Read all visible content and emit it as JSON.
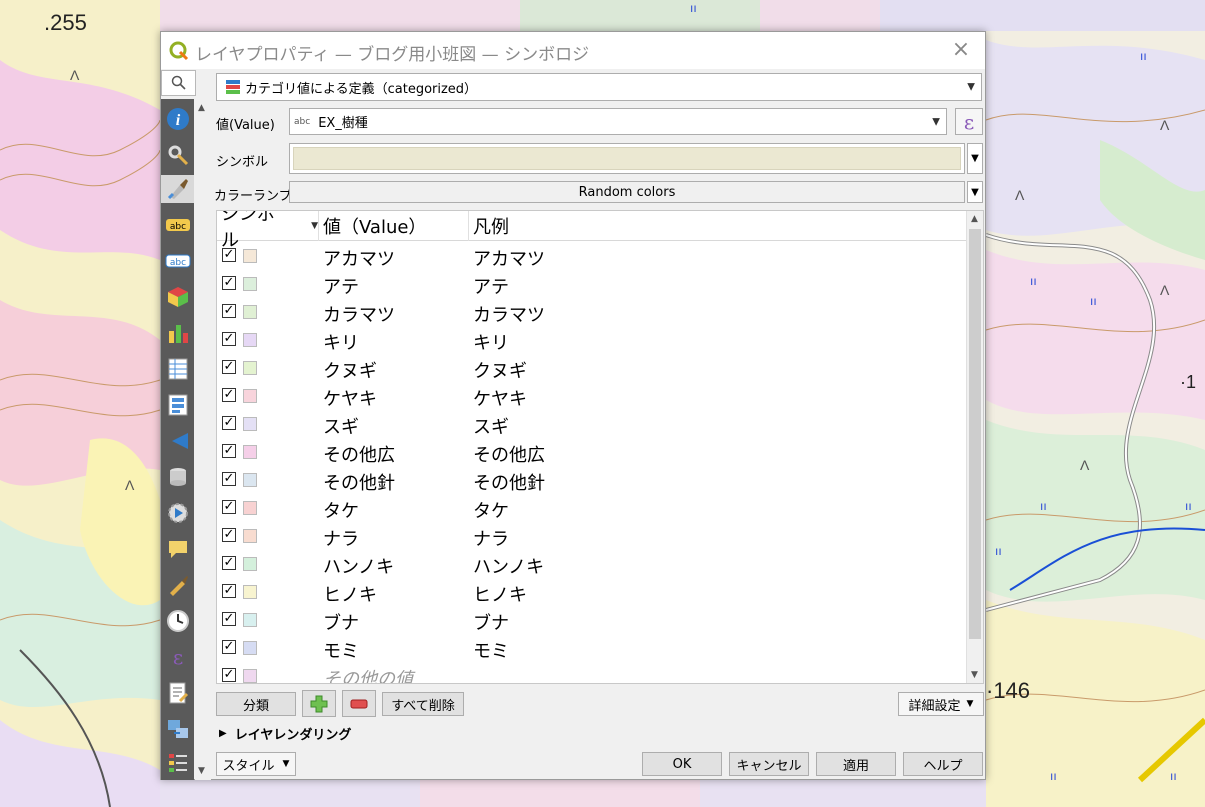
{
  "map": {
    "labels": [
      ".255",
      "·146",
      "·1"
    ]
  },
  "dialog": {
    "title": "レイヤプロパティ — ブログ用小班図 — シンボロジ",
    "close": "×"
  },
  "renderer": {
    "selected": "カテゴリ値による定義（categorized）"
  },
  "value": {
    "label": "値(Value)",
    "type_tag": "abc",
    "field": "EX_樹種",
    "expr_button": "ε"
  },
  "symbol": {
    "label": "シンボル",
    "color": "#ebe8d2"
  },
  "ramp": {
    "label": "カラーランプ",
    "value": "Random colors"
  },
  "table": {
    "headers": {
      "symbol": "シンボル",
      "value": "値（Value）",
      "legend": "凡例"
    },
    "rows": [
      {
        "value": "アカマツ",
        "legend": "アカマツ",
        "color": "#f5e8d8",
        "checked": "✓"
      },
      {
        "value": "アテ",
        "legend": "アテ",
        "color": "#dcefdc",
        "checked": "✓"
      },
      {
        "value": "カラマツ",
        "legend": "カラマツ",
        "color": "#e0f0d4",
        "checked": "✓"
      },
      {
        "value": "キリ",
        "legend": "キリ",
        "color": "#e6d8f5",
        "checked": "✓"
      },
      {
        "value": "クヌギ",
        "legend": "クヌギ",
        "color": "#e4f3d0",
        "checked": "✓"
      },
      {
        "value": "ケヤキ",
        "legend": "ケヤキ",
        "color": "#f8d4dc",
        "checked": "✓"
      },
      {
        "value": "スギ",
        "legend": "スギ",
        "color": "#e4e0f5",
        "checked": "✓"
      },
      {
        "value": "その他広",
        "legend": "その他広",
        "color": "#f5cfe8",
        "checked": "✓"
      },
      {
        "value": "その他針",
        "legend": "その他針",
        "color": "#dbe6f0",
        "checked": "✓"
      },
      {
        "value": "タケ",
        "legend": "タケ",
        "color": "#f8d2d2",
        "checked": "✓"
      },
      {
        "value": "ナラ",
        "legend": "ナラ",
        "color": "#f8dcd0",
        "checked": "✓"
      },
      {
        "value": "ハンノキ",
        "legend": "ハンノキ",
        "color": "#d4f0dc",
        "checked": "✓"
      },
      {
        "value": "ヒノキ",
        "legend": "ヒノキ",
        "color": "#f8f4d0",
        "checked": "✓"
      },
      {
        "value": "ブナ",
        "legend": "ブナ",
        "color": "#d8f0ef",
        "checked": "✓"
      },
      {
        "value": "モミ",
        "legend": "モミ",
        "color": "#d6dcf3",
        "checked": "✓"
      },
      {
        "value": "その他の値",
        "legend": "",
        "color": "#efd8ef",
        "checked": "✓"
      }
    ]
  },
  "buttons": {
    "classify": "分類",
    "add": "+",
    "remove": "−",
    "delete_all": "すべて削除",
    "advanced": "詳細設定",
    "layer_rendering": "レイヤレンダリング",
    "style": "スタイル",
    "ok": "OK",
    "cancel": "キャンセル",
    "apply": "適用",
    "help": "ヘルプ"
  },
  "colors": {
    "accent": "#1f6fb0",
    "sidebar": "#5a5a5a"
  }
}
